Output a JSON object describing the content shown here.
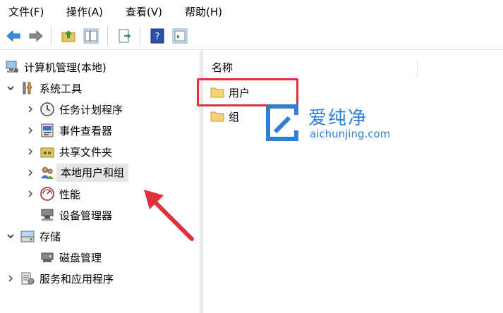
{
  "menu": {
    "items": [
      "文件(F)",
      "操作(A)",
      "查看(V)",
      "帮助(H)"
    ]
  },
  "toolbar": {
    "buttons": [
      "back-icon",
      "forward-icon",
      "up-folder-icon",
      "show-hide-tree-icon",
      "export-list-icon",
      "help-icon",
      "properties-icon"
    ]
  },
  "tree": {
    "root": "计算机管理(本地)",
    "system_tools": "系统工具",
    "task_scheduler": "任务计划程序",
    "event_viewer": "事件查看器",
    "shared_folders": "共享文件夹",
    "local_users": "本地用户和组",
    "performance": "性能",
    "device_manager": "设备管理器",
    "storage": "存储",
    "disk_management": "磁盘管理",
    "services_apps": "服务和应用程序"
  },
  "list": {
    "column_name": "名称",
    "items": [
      "用户",
      "组"
    ]
  },
  "watermark": {
    "title": "爱纯净",
    "url": "aichunjing.com"
  },
  "colors": {
    "highlight": "#e0303a",
    "watermark": "#2e7fd8",
    "selection": "#e5e5e5"
  }
}
